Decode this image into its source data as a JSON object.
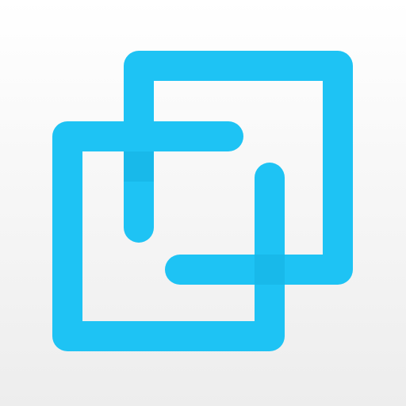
{
  "icon": {
    "name": "overlapping-squares-logo",
    "stroke_color": "#1ec3f4",
    "shadow_color": "#0fa6d8",
    "background_top": "#ffffff",
    "background_bottom": "#ededed"
  }
}
